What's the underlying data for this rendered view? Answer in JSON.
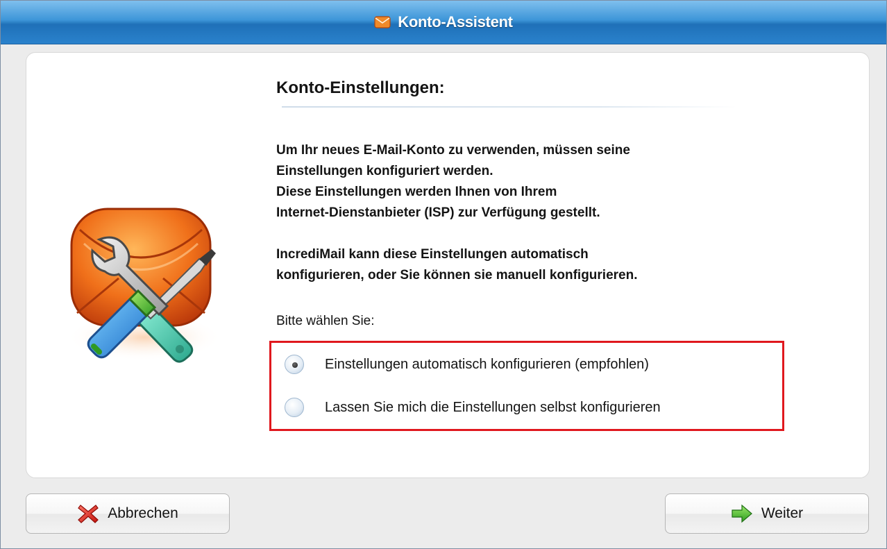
{
  "window": {
    "title": "Konto-Assistent"
  },
  "content": {
    "heading": "Konto-Einstellungen:",
    "paragraph1": [
      "Um Ihr neues E-Mail-Konto zu verwenden, müssen seine",
      "Einstellungen konfiguriert werden.",
      "Diese Einstellungen werden Ihnen von Ihrem",
      "Internet-Dienstanbieter (ISP) zur Verfügung gestellt."
    ],
    "paragraph2": [
      "IncrediMail kann diese Einstellungen automatisch",
      "konfigurieren, oder Sie können sie manuell konfigurieren."
    ],
    "choose_label": "Bitte wählen Sie:",
    "options": [
      {
        "label": "Einstellungen automatisch konfigurieren (empfohlen)",
        "selected": true
      },
      {
        "label": "Lassen Sie mich die Einstellungen selbst konfigurieren",
        "selected": false
      }
    ],
    "highlight_color": "#e0181e"
  },
  "buttons": {
    "cancel": {
      "label": "Abbrechen",
      "icon": "red-x-icon"
    },
    "next": {
      "label": "Weiter",
      "icon": "green-arrow-right-icon"
    }
  },
  "icons": {
    "title": "envelope-icon",
    "illustration": "envelope-tools-icon"
  }
}
